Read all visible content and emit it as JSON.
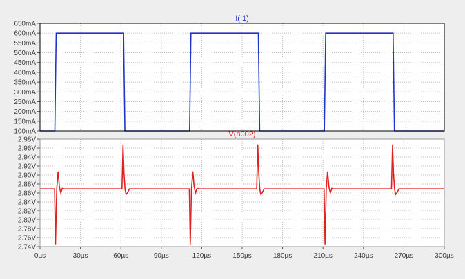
{
  "chart_data": [
    {
      "type": "line",
      "title": "I(I1)",
      "xlabel": "",
      "ylabel": "",
      "color": "#2233cc",
      "xlim": [
        0,
        300
      ],
      "ylim": [
        100,
        650
      ],
      "y_ticks": [
        "100mA",
        "150mA",
        "200mA",
        "250mA",
        "300mA",
        "350mA",
        "400mA",
        "450mA",
        "500mA",
        "550mA",
        "600mA",
        "650mA"
      ],
      "y_tick_values": [
        100,
        150,
        200,
        250,
        300,
        350,
        400,
        450,
        500,
        550,
        600,
        650
      ],
      "x_ticks": [
        0,
        30,
        60,
        90,
        120,
        150,
        180,
        210,
        240,
        270,
        300
      ],
      "series": [
        {
          "x": [
            0,
            11,
            12,
            62,
            63,
            111,
            112,
            162,
            163,
            211,
            212,
            262,
            263,
            300
          ],
          "y": [
            100,
            100,
            600,
            600,
            100,
            100,
            600,
            600,
            100,
            100,
            600,
            600,
            100,
            100
          ]
        }
      ]
    },
    {
      "type": "line",
      "title": "V(n002)",
      "xlabel": "",
      "ylabel": "",
      "color": "#dd2222",
      "xlim": [
        0,
        300
      ],
      "ylim": [
        2.74,
        2.98
      ],
      "y_ticks": [
        "2.74V",
        "2.76V",
        "2.78V",
        "2.80V",
        "2.82V",
        "2.84V",
        "2.86V",
        "2.88V",
        "2.90V",
        "2.92V",
        "2.94V",
        "2.96V",
        "2.98V"
      ],
      "y_tick_values": [
        2.74,
        2.76,
        2.78,
        2.8,
        2.82,
        2.84,
        2.86,
        2.88,
        2.9,
        2.92,
        2.94,
        2.96,
        2.98
      ],
      "x_ticks": [
        "0µs",
        "30µs",
        "60µs",
        "90µs",
        "120µs",
        "150µs",
        "180µs",
        "210µs",
        "240µs",
        "270µs",
        "300µs"
      ],
      "x_tick_values": [
        0,
        30,
        60,
        90,
        120,
        150,
        180,
        210,
        240,
        270,
        300
      ],
      "series": [
        {
          "x": [
            0,
            10.8,
            11.5,
            12.4,
            13.4,
            14.4,
            15.4,
            16.5,
            18,
            60.8,
            61.6,
            62.3,
            63.1,
            63.9,
            65,
            66.3,
            68,
            110.8,
            111.5,
            112.4,
            113.4,
            114.4,
            115.4,
            116.5,
            118,
            160.8,
            161.6,
            162.3,
            163.1,
            163.9,
            165,
            166.3,
            168,
            210.8,
            211.5,
            212.4,
            213.4,
            214.4,
            215.4,
            216.5,
            218,
            260.8,
            261.6,
            262.3,
            263.1,
            263.9,
            265,
            266.3,
            268,
            300
          ],
          "y": [
            2.869,
            2.869,
            2.745,
            2.869,
            2.908,
            2.873,
            2.86,
            2.87,
            2.869,
            2.869,
            2.968,
            2.905,
            2.868,
            2.857,
            2.861,
            2.869,
            2.869,
            2.869,
            2.745,
            2.869,
            2.908,
            2.873,
            2.86,
            2.87,
            2.869,
            2.869,
            2.968,
            2.905,
            2.868,
            2.857,
            2.861,
            2.869,
            2.869,
            2.869,
            2.745,
            2.869,
            2.908,
            2.873,
            2.86,
            2.87,
            2.869,
            2.869,
            2.968,
            2.905,
            2.868,
            2.857,
            2.861,
            2.869,
            2.869,
            2.869
          ]
        }
      ]
    }
  ]
}
